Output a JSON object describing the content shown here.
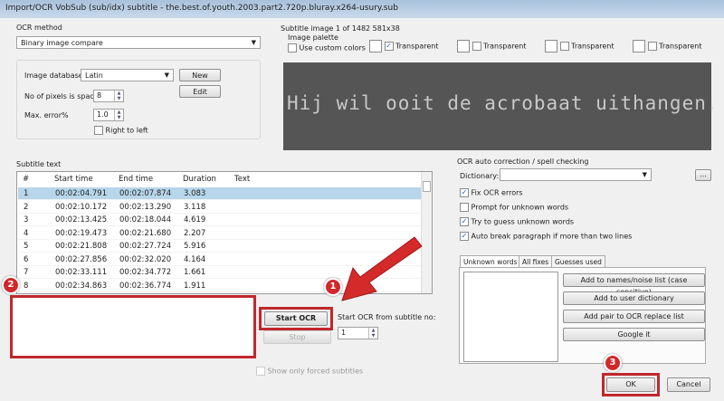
{
  "window": {
    "title": "Import/OCR VobSub (sub/idx) subtitle - the.best.of.youth.2003.part2.720p.bluray.x264-usury.sub"
  },
  "ocr_method": {
    "label": "OCR method",
    "value": "Binary image compare"
  },
  "image_db": {
    "label": "Image database",
    "value": "Latin",
    "new": "New",
    "edit": "Edit"
  },
  "pixels_space": {
    "label": "No of pixels is space",
    "value": "8"
  },
  "max_error": {
    "label": "Max. error%",
    "value": "1.0"
  },
  "right_to_left": {
    "label": "Right to left",
    "checked": false
  },
  "subtitle_image": {
    "label": "Subtitle image 1 of 1482   581x38",
    "palette_label": "Image palette",
    "custom_colors": "Use custom colors",
    "transparent": [
      "Transparent",
      "Transparent",
      "Transparent",
      "Transparent"
    ],
    "image_text": "Hij wil ooit de acrobaat uithangen."
  },
  "subtitle_text": {
    "label": "Subtitle text",
    "columns": [
      "#",
      "Start time",
      "End time",
      "Duration",
      "Text"
    ],
    "rows": [
      [
        "1",
        "00:02:04.791",
        "00:02:07.874",
        "3.083"
      ],
      [
        "2",
        "00:02:10.172",
        "00:02:13.290",
        "3.118"
      ],
      [
        "3",
        "00:02:13.425",
        "00:02:18.044",
        "4.619"
      ],
      [
        "4",
        "00:02:19.473",
        "00:02:21.680",
        "2.207"
      ],
      [
        "5",
        "00:02:21.808",
        "00:02:27.724",
        "5.916"
      ],
      [
        "6",
        "00:02:27.856",
        "00:02:32.020",
        "4.164"
      ],
      [
        "7",
        "00:02:33.111",
        "00:02:34.772",
        "1.661"
      ],
      [
        "8",
        "00:02:34.863",
        "00:02:36.774",
        "1.911"
      ]
    ]
  },
  "controls": {
    "start_ocr": "Start OCR",
    "stop": "Stop",
    "start_from_label": "Start OCR from subtitle no:",
    "start_from_value": "1",
    "forced_only": "Show only forced subtitles"
  },
  "autocorrect": {
    "label": "OCR auto correction / spell checking",
    "dictionary_label": "Dictionary:",
    "dictionary_value": "",
    "more": "...",
    "options": [
      {
        "label": "Fix OCR errors",
        "checked": true
      },
      {
        "label": "Prompt for unknown words",
        "checked": false
      },
      {
        "label": "Try to guess unknown words",
        "checked": true
      },
      {
        "label": "Auto break paragraph if more than two lines",
        "checked": true
      }
    ],
    "tabs": [
      "Unknown words",
      "All fixes",
      "Guesses used"
    ],
    "buttons": [
      "Add to names/noise list (case sensitive)",
      "Add to user dictionary",
      "Add pair to OCR replace list",
      "Google it"
    ]
  },
  "footer": {
    "ok": "OK",
    "cancel": "Cancel"
  },
  "annotations": [
    "1",
    "2",
    "3"
  ],
  "colors": {
    "highlight": "#c0282c",
    "selection": "#b7d6ea"
  }
}
